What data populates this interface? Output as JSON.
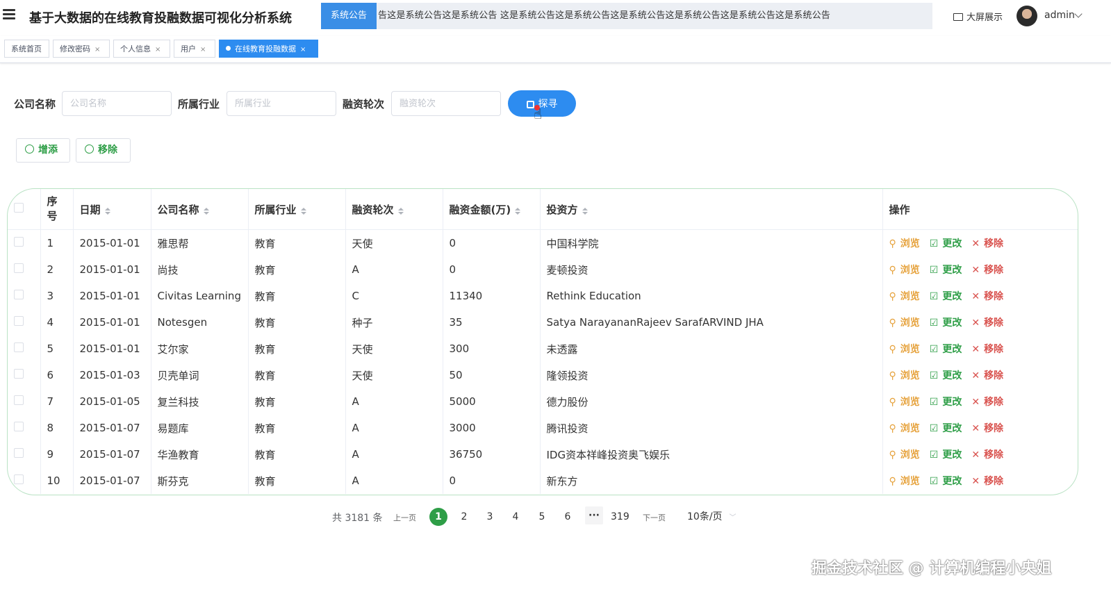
{
  "header": {
    "title": "基于大数据的在线教育投融数据可视化分析系统",
    "notice_tag": "系统公告",
    "notice_text": "告这是系统公告这是系统公告    这是系统公告这是系统公告这是系统公告这是系统公告这是系统公告这是系统公告",
    "bigscreen_label": "大屏展示",
    "user_name": "admin"
  },
  "tabs": [
    {
      "label": "系统首页"
    },
    {
      "label": "修改密码",
      "close": "×"
    },
    {
      "label": "个人信息",
      "close": "×"
    },
    {
      "label": "用户",
      "close": "×"
    },
    {
      "label": "在线教育投融数据",
      "close": "×"
    }
  ],
  "search": {
    "company_label": "公司名称",
    "company_placeholder": "公司名称",
    "industry_label": "所属行业",
    "industry_placeholder": "所属行业",
    "round_label": "融资轮次",
    "round_placeholder": "融资轮次",
    "button": "探寻"
  },
  "actions": {
    "add": "增添",
    "remove": "移除"
  },
  "table": {
    "headers": [
      "序号",
      "日期",
      "公司名称",
      "所属行业",
      "融资轮次",
      "融资金额(万)",
      "投资方",
      "操作"
    ],
    "index_header_line1": "序",
    "index_header_line2": "号",
    "op_labels": {
      "view": "浏览",
      "edit": "更改",
      "del": "移除"
    },
    "rows": [
      [
        "1",
        "2015-01-01",
        "雅思帮",
        "教育",
        "天使",
        "0",
        "中国科学院"
      ],
      [
        "2",
        "2015-01-01",
        "尚技",
        "教育",
        "A",
        "0",
        "麦顿投资"
      ],
      [
        "3",
        "2015-01-01",
        "Civitas Learning",
        "教育",
        "C",
        "11340",
        "Rethink Education"
      ],
      [
        "4",
        "2015-01-01",
        "Notesgen",
        "教育",
        "种子",
        "35",
        "Satya NarayananRajeev SarafARVIND JHA"
      ],
      [
        "5",
        "2015-01-01",
        "艾尔家",
        "教育",
        "天使",
        "300",
        "未透露"
      ],
      [
        "6",
        "2015-01-03",
        "贝壳单词",
        "教育",
        "天使",
        "50",
        "隆领投资"
      ],
      [
        "7",
        "2015-01-05",
        "复兰科技",
        "教育",
        "A",
        "5000",
        "德力股份"
      ],
      [
        "8",
        "2015-01-07",
        "易题库",
        "教育",
        "A",
        "3000",
        "腾讯投资"
      ],
      [
        "9",
        "2015-01-07",
        "华渔教育",
        "教育",
        "A",
        "36750",
        "IDG资本祥峰投资奥飞娱乐"
      ],
      [
        "10",
        "2015-01-07",
        "斯芬克",
        "教育",
        "A",
        "0",
        "新东方"
      ]
    ]
  },
  "pagination": {
    "total": "共 3181 条",
    "prev": "上一页",
    "pages": [
      "1",
      "2",
      "3",
      "4",
      "5",
      "6"
    ],
    "more": "···",
    "last": "319",
    "next": "下一页",
    "page_size": "10条/页"
  },
  "watermark": "掘金技术社区 @ 计算机编程小央姐",
  "colors": {
    "primary": "#2d8cf0",
    "green": "#2e9e47",
    "orange": "#e6a23c",
    "red": "#d9534f"
  }
}
